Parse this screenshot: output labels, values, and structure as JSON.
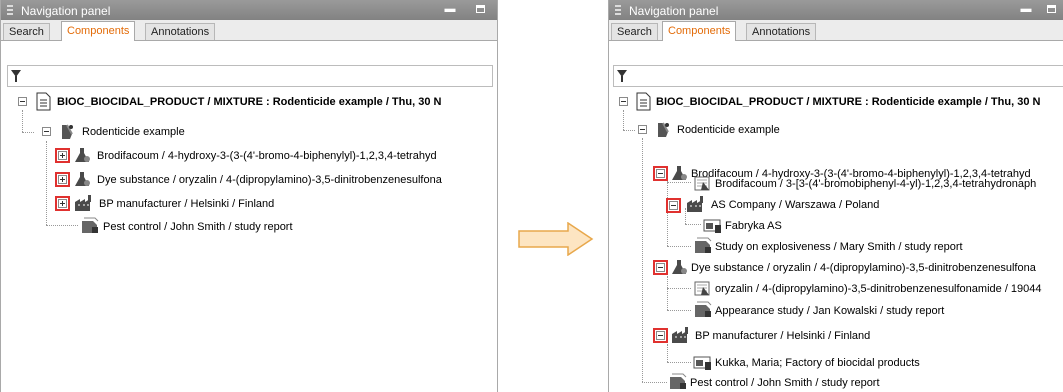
{
  "left": {
    "title": "Navigation panel",
    "tabs": [
      "Search",
      "Components",
      "Annotations"
    ],
    "rows": [
      "BIOC_BIOCIDAL_PRODUCT / MIXTURE : Rodenticide example / Thu, 30 N",
      "Rodenticide example",
      "Brodifacoum / 4-hydroxy-3-(3-(4'-bromo-4-biphenylyl)-1,2,3,4-tetrahyd",
      "Dye substance / oryzalin / 4-(dipropylamino)-3,5-dinitrobenzenesulfona",
      "BP manufacturer / Helsinki / Finland",
      "Pest control / John Smith / study report"
    ]
  },
  "right": {
    "title": "Navigation panel",
    "tabs": [
      "Search",
      "Components",
      "Annotations"
    ],
    "rows": [
      "BIOC_BIOCIDAL_PRODUCT / MIXTURE : Rodenticide example / Thu, 30 N",
      "Rodenticide example",
      "Brodifacoum / 4-hydroxy-3-(3-(4'-bromo-4-biphenylyl)-1,2,3,4-tetrahyd",
      "Brodifacoum / 3-[3-(4'-bromobiphenyl-4-yl)-1,2,3,4-tetrahydronaph",
      "AS Company / Warszawa / Poland",
      "Fabryka AS",
      "Study on explosiveness / Mary Smith / study report",
      "Dye substance / oryzalin / 4-(dipropylamino)-3,5-dinitrobenzenesulfona",
      "oryzalin / 4-(dipropylamino)-3,5-dinitrobenzenesulfonamide / 19044",
      "Appearance study / Jan Kowalski / study report",
      "BP manufacturer / Helsinki / Finland",
      "Kukka, Maria; Factory of biocidal products",
      "Pest control / John Smith / study report"
    ]
  },
  "colors": {
    "titlebar": "#8c8c8c",
    "active_tab_text": "#e36c09",
    "highlight": "#e0312f",
    "arrow_fill": "#fde5c2",
    "arrow_stroke": "#e8a84c"
  },
  "icons": [
    "filter-icon",
    "document-icon",
    "mixture-icon",
    "substance-icon",
    "legal-entity-icon",
    "site-icon",
    "endpoint-study-icon",
    "reference-substance-icon"
  ]
}
